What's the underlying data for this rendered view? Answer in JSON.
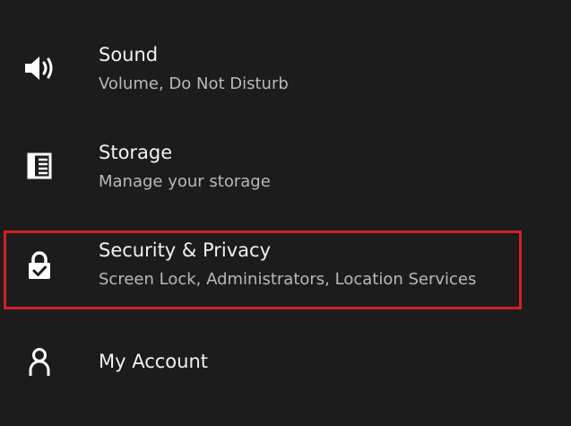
{
  "settings": {
    "items": [
      {
        "id": "sound",
        "icon": "speaker-icon",
        "title": "Sound",
        "subtitle": "Volume, Do Not Disturb"
      },
      {
        "id": "storage",
        "icon": "storage-icon",
        "title": "Storage",
        "subtitle": "Manage your storage"
      },
      {
        "id": "security-privacy",
        "icon": "lock-icon",
        "title": "Security & Privacy",
        "subtitle": "Screen Lock, Administrators, Location Services",
        "highlighted": true
      },
      {
        "id": "my-account",
        "icon": "person-icon",
        "title": "My Account"
      }
    ]
  },
  "colors": {
    "background": "#1c1c1c",
    "title_text": "#f2f2f2",
    "subtitle_text": "#b9b9b9",
    "icon": "#ffffff",
    "highlight": "#d31f26"
  }
}
